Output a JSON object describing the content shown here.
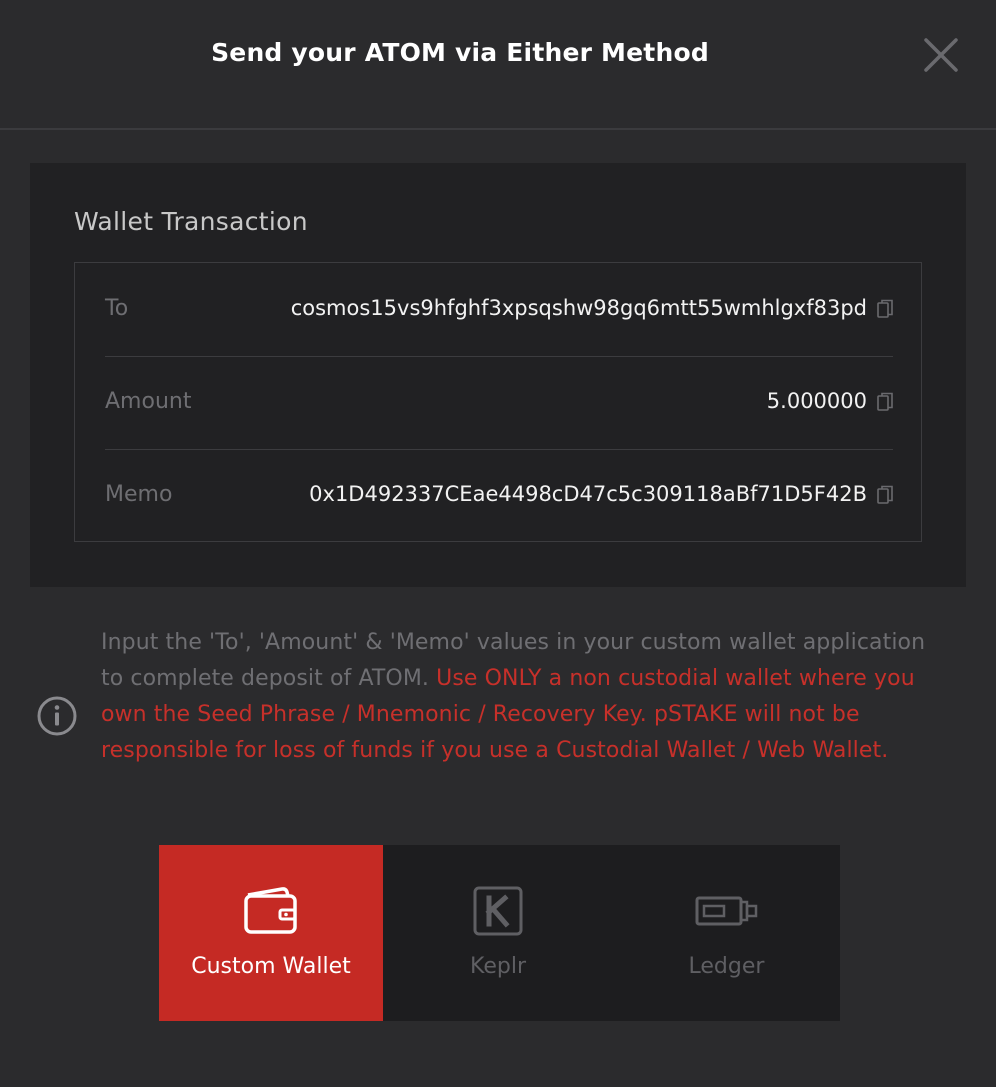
{
  "modal": {
    "title": "Send your ATOM via Either Method",
    "close_icon": "close-icon"
  },
  "wallet_transaction": {
    "title": "Wallet Transaction",
    "rows": [
      {
        "label": "To",
        "value": "cosmos15vs9hfghf3xpsqshw98gq6mtt55wmhlgxf83pd"
      },
      {
        "label": "Amount",
        "value": "5.000000"
      },
      {
        "label": "Memo",
        "value": "0x1D492337CEae4498cD47c5c309118aBf71D5F42B"
      }
    ]
  },
  "info": {
    "icon": "info-icon",
    "text_normal": "Input the 'To', 'Amount' & 'Memo' values in your custom wallet application to complete deposit of ATOM. ",
    "text_warning": "Use ONLY a non custodial wallet where you own the Seed Phrase / Mnemonic / Recovery Key. pSTAKE will not be responsible for loss of funds if you use a Custodial Wallet / Web Wallet."
  },
  "methods": [
    {
      "label": "Custom Wallet",
      "icon": "wallet-icon",
      "selected": true
    },
    {
      "label": "Keplr",
      "icon": "keplr-icon",
      "selected": false
    },
    {
      "label": "Ledger",
      "icon": "ledger-icon",
      "selected": false
    }
  ],
  "colors": {
    "background": "#2b2b2d",
    "panel": "#212123",
    "accent": "#c52a24",
    "warning_text": "#c7302a"
  }
}
